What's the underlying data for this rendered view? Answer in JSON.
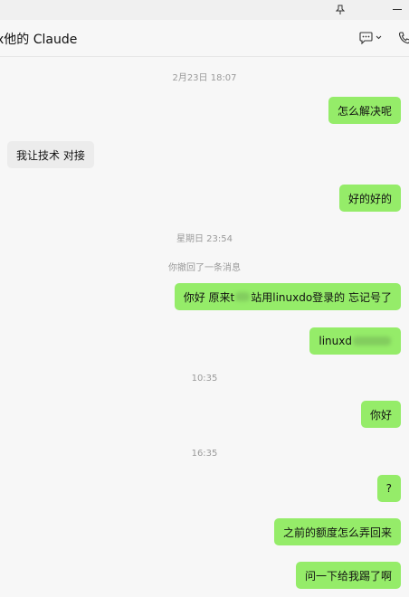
{
  "window": {
    "pin_icon": "pin-icon",
    "minimize_icon": "minimize-icon"
  },
  "header": {
    "title": "x他的 Claude",
    "chat_icon": "chat-bubble-icon",
    "call_icon": "phone-icon"
  },
  "messages": [
    {
      "kind": "time",
      "text": "2月23日 18:07"
    },
    {
      "kind": "out",
      "text": "怎么解决呢"
    },
    {
      "kind": "in",
      "text": "我让技术 对接"
    },
    {
      "kind": "out",
      "text": "好的好的"
    },
    {
      "kind": "time",
      "text": "星期日 23:54"
    },
    {
      "kind": "notice",
      "text": "你撤回了一条消息"
    },
    {
      "kind": "out",
      "text_before": "你好 原来t",
      "text_after": "站用linuxdo登录的 忘记号了"
    },
    {
      "kind": "out",
      "text": "linuxd"
    },
    {
      "kind": "time",
      "text": "10:35"
    },
    {
      "kind": "out",
      "text": "你好"
    },
    {
      "kind": "time",
      "text": "16:35"
    },
    {
      "kind": "out",
      "text": "?"
    },
    {
      "kind": "out",
      "text": "之前的额度怎么弄回来"
    },
    {
      "kind": "out",
      "text": "问一下给我踢了啊"
    }
  ]
}
